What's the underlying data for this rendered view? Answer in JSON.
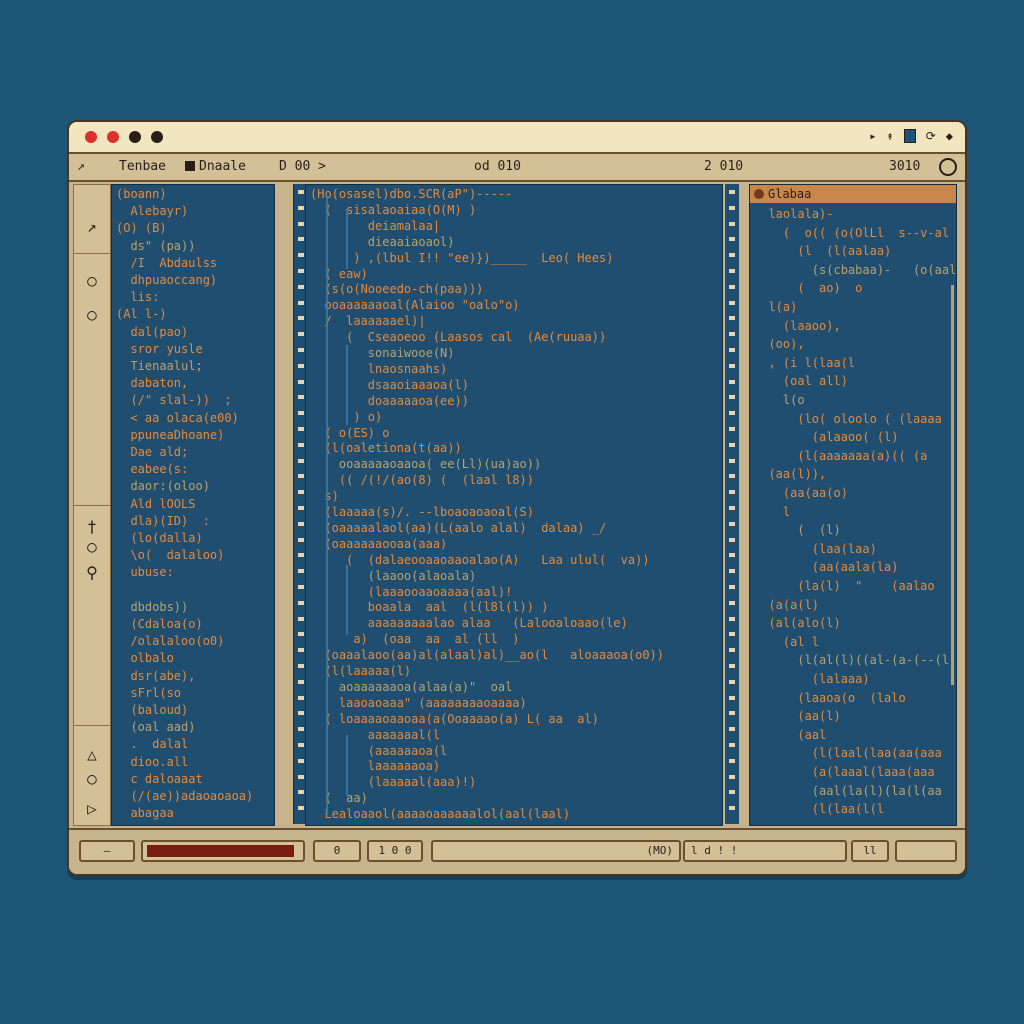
{
  "window": {
    "title_icons": [
      "▸",
      "↟",
      "▮",
      "⟳",
      "◆"
    ]
  },
  "toolbar": {
    "item1": "Tenbae",
    "item2": "Dnaale",
    "item3": "D 00 >",
    "center": "od 010",
    "right1": "2 010",
    "right2": "3010"
  },
  "left_gutter": {
    "icons": [
      "↗",
      "○",
      "○",
      "†",
      "○",
      "⚲",
      "△",
      "○",
      "▷"
    ]
  },
  "left_panel": {
    "lines": [
      "(boann)",
      "  Alebayr)",
      "(O) (B)",
      "  ds\" (pa))",
      "  /I  Abdaulss",
      "  dhpuaoccang)",
      "  lis:",
      "(Al l-)",
      "  dal(pao)",
      "  sror yusle",
      "  Tienaalul;",
      "  dabaton,",
      "  (/\" slal-))  ;",
      "  < aa olaca(e00)",
      "  ppuneaDhoane)",
      "  Dae ald;",
      "  eabee(s:",
      "  daor:(oloo)",
      "  Ald lOOLS",
      "  dla)(ID)  :",
      "  (lo(dalla)",
      "  \\o(  dalaloo)",
      "  ubuse:",
      "",
      "  dbdobs))",
      "  (Cdaloa(o)",
      "  /olalaloo(o0)",
      "  olbalo",
      "  dsr(abe),",
      "  sFrl(so",
      "  (baloud)",
      "  (oal aad)",
      "  .  dalal",
      "  dioo.all",
      "  c daloaaat",
      "  (/(ae))adaoaoaoa)",
      "  abagaa"
    ]
  },
  "main_panel": {
    "lines": [
      "(Ho(osasel)dbo.SCR(aP\")-----",
      "  (  sisalaoaiaa(O(M) )",
      "        deiamalaa|",
      "        dieaaiaoaol)",
      "      ) ,(lbul I!! \"ee)})_____  Leo( Hees)",
      "  ( eaw)",
      "  (s(o(Nooeedo-ch(paa)))",
      "  ooaaaaaaoal(Alaioo \"oalo\"o)",
      "  /  laaaaaael)|",
      "     (  Cseaoeoo (Laasos cal  (Ae(ruuaa))",
      "        sonaiwooe(N)",
      "        lnaosnaahs)",
      "        dsaaoiaaaoa(l)",
      "        doaaaaaoa(ee))",
      "      ) o)",
      "  ( o(ES) o",
      "  (l(oaletiona(t(aa))",
      "    ooaaaaaoaaoa( ee(Ll)(ua)ao))",
      "    (( /(!/(ao(8) (  (laal l8))",
      "  s)",
      "  (laaaaa(s)/. --lboaoaoaoal(S)",
      "  (oaaaaalaol(aa)(L(aalo alal)  dalaa) _/",
      "  (oaaaaaaooaa(aaa)",
      "     (  (dalaeooaaoaaoalao(A)   Laa ulul(  va))",
      "        (laaoo(alaoala)",
      "        (laaaooaaoaaaa(aal)!",
      "        boaala  aal  (l(l8l(l)) )",
      "        aaaaaaaaalao alaa   (Lalooaloaao(le)",
      "      a)  (oaa  aa  al (ll  )",
      "  (oaaalaoo(aa)al(alaal)al)__ao(l   aloaaaoa(o0))",
      "  (l(laaaaa(l)",
      "    aoaaaaaaoa(alaa(a)\"  oal",
      "    laaoaoaaa\" (aaaaaaaaoaaaa)",
      "  ( loaaaaoaaoaa(a(Ooaaaao(a) L( aa  al)",
      "        aaaaaaal(l",
      "        (aaaaaaoa(l",
      "        laaaaaaoa)",
      "        (laaaaal(aaa)!)",
      "  (  aa)",
      "  Lealoaaol(aaaaoaaaaaalol(aal(laal)"
    ]
  },
  "right_panel": {
    "header": "Glabaa",
    "lines": [
      "  laolala)-",
      "    (  o(( (o(OlLl  s--v-al",
      "      (l  (l(aalaa)",
      "        (s(cbabaa)-   (o(aala",
      "      (  ao)  o",
      "  l(a)",
      "    (laaoo),",
      "  (oo),",
      "  , (i l(laa(l",
      "    (oal all)",
      "    l(o",
      "      (lo( oloolo ( (laaaa (",
      "        (alaaoo( (l)",
      "      (l(aaaaaaa(a)(( (a",
      "  (aa(l)),",
      "    (aa(aa(o)",
      "    l",
      "      (  (l)",
      "        (laa(laa)",
      "        (aa(aala(la)",
      "      (la(l)  \"    (aalao",
      "  (a(a(l)",
      "  (al(alo(l)",
      "    (al l",
      "      (l(al(l)((al-(a-(--(l",
      "        (lalaaa)",
      "      (laaoa(o  (lalo",
      "      (aa(l)",
      "      (aal",
      "        (l(laal(laa(aa(aaa",
      "        (a(laaal(laaa(aaa",
      "        (aal(la(l)(la(l(aa",
      "        (l(laa(l(l"
    ]
  },
  "statusbar": {
    "btn1": "—",
    "progress_fraction": 0.97,
    "btn3": "0",
    "btn4": "1 0 0",
    "btn5": "(MO)",
    "btn6": "l d  ! !",
    "btn7": "",
    "btn8": "ll"
  }
}
